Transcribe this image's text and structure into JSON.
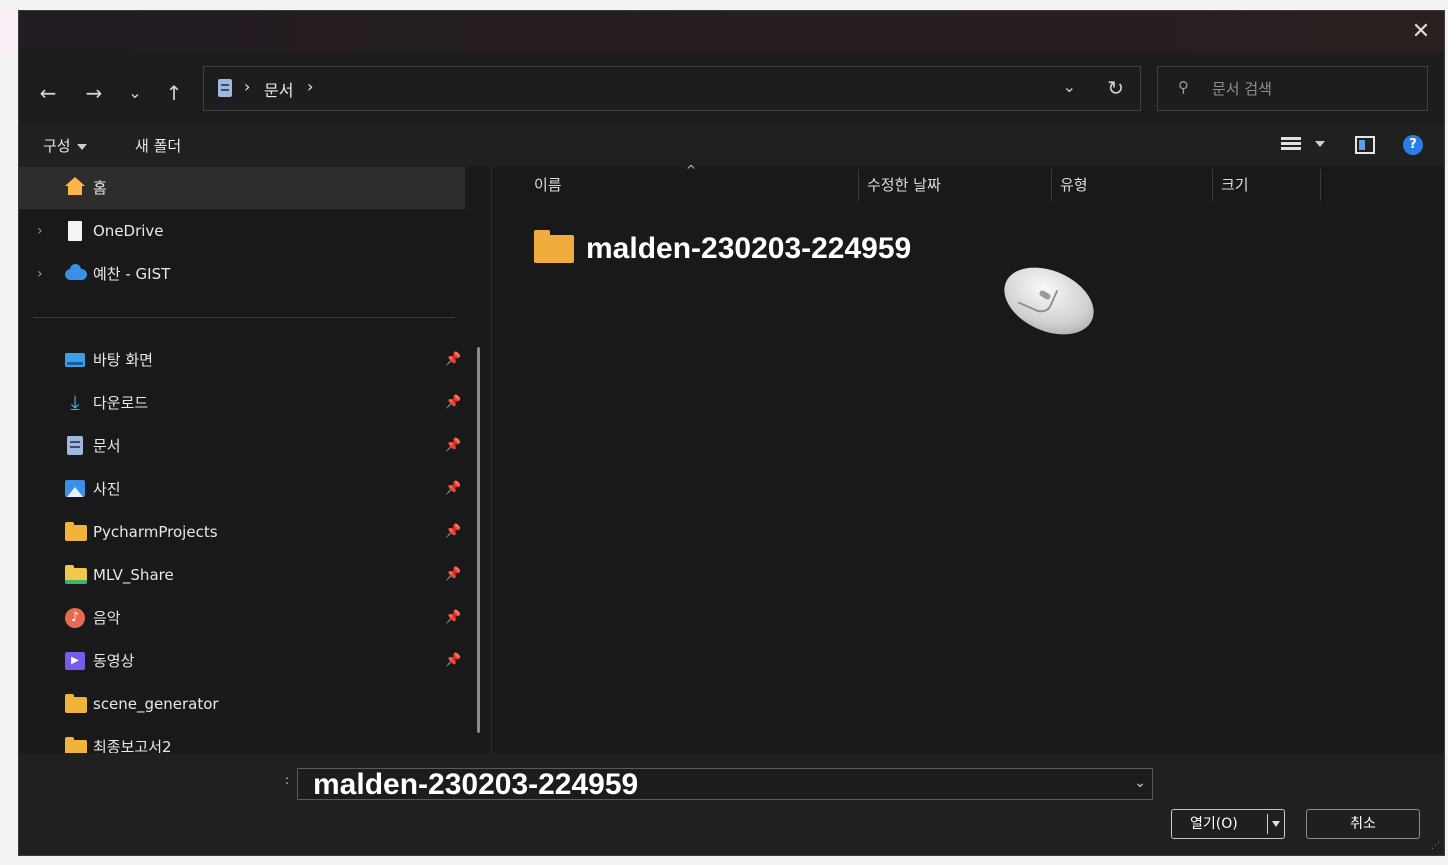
{
  "window": {
    "close_label": "✕"
  },
  "nav": {
    "back_icon": "arrow-left-icon",
    "forward_icon": "arrow-right-icon",
    "recent_icon": "chevron-down-icon",
    "up_icon": "arrow-up-icon",
    "breadcrumb": [
      "›",
      "문서",
      "›"
    ],
    "refresh_icon": "refresh-icon"
  },
  "search": {
    "placeholder": "문서 검색"
  },
  "toolbar": {
    "organize_label": "구성",
    "new_folder_label": "새 폴더"
  },
  "sidebar": {
    "items": [
      {
        "label": "홈",
        "icon": "home-icon"
      },
      {
        "label": "OneDrive",
        "icon": "onedrive-file-icon"
      },
      {
        "label": "예찬 - GIST",
        "icon": "cloud-icon"
      },
      {
        "label": "바탕 화면",
        "icon": "desktop-icon"
      },
      {
        "label": "다운로드",
        "icon": "download-icon"
      },
      {
        "label": "문서",
        "icon": "document-icon"
      },
      {
        "label": "사진",
        "icon": "pictures-icon"
      },
      {
        "label": "PycharmProjects",
        "icon": "folder-icon"
      },
      {
        "label": "MLV_Share",
        "icon": "folder-icon"
      },
      {
        "label": "음악",
        "icon": "music-icon"
      },
      {
        "label": "동영상",
        "icon": "video-icon"
      },
      {
        "label": "scene_generator",
        "icon": "folder-icon"
      },
      {
        "label": "최종보고서2",
        "icon": "folder-icon"
      }
    ]
  },
  "columns": {
    "name": "이름",
    "modified": "수정한 날짜",
    "type": "유형",
    "size": "크기"
  },
  "files": [
    {
      "name": "malden-230203-224959",
      "icon": "folder-icon"
    }
  ],
  "footer": {
    "filename_value": "malden-230203-224959",
    "open_label": "열기(O)",
    "cancel_label": "취소"
  }
}
